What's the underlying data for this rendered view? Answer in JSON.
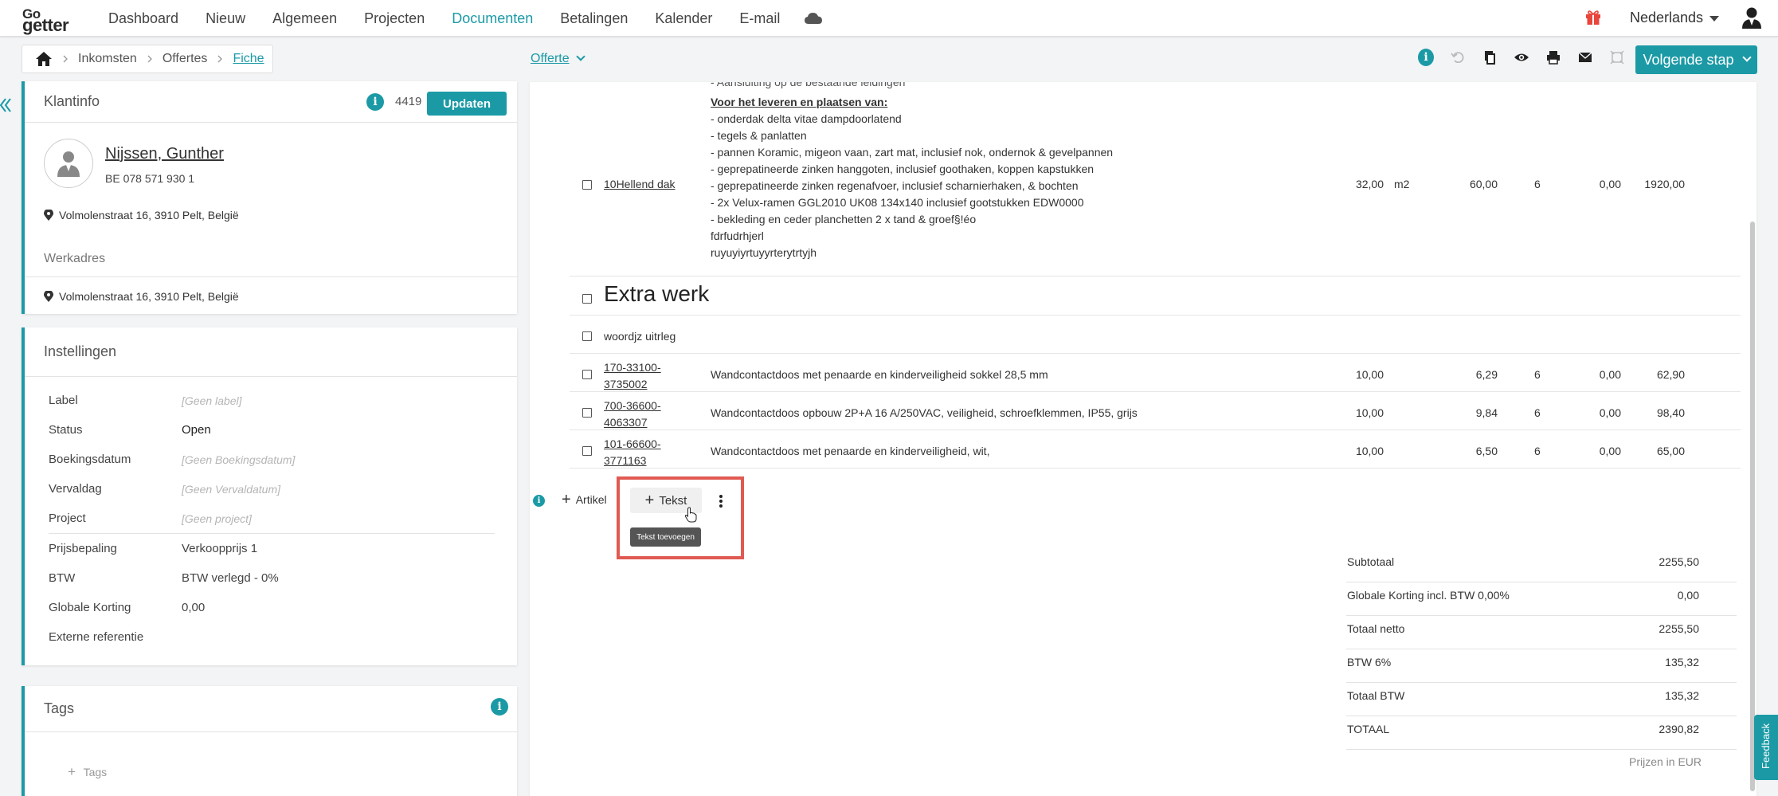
{
  "nav": {
    "logo_top": "Go",
    "logo_bottom": "getter",
    "items": [
      "Dashboard",
      "Nieuw",
      "Algemeen",
      "Projecten",
      "Documenten",
      "Betalingen",
      "Kalender",
      "E-mail"
    ],
    "active": "Documenten",
    "language": "Nederlands"
  },
  "breadcrumb": {
    "items": [
      "Inkomsten",
      "Offertes",
      "Fiche"
    ]
  },
  "doc_type": "Offerte",
  "next_step_label": "Volgende stap",
  "klantinfo": {
    "title": "Klantinfo",
    "number": "4419",
    "update_label": "Updaten",
    "name": "Nijssen, Gunther",
    "vat": "BE 078 571 930 1",
    "address": "Volmolenstraat 16, 3910 Pelt, België",
    "werkadres_label": "Werkadres",
    "werkadres": "Volmolenstraat 16, 3910 Pelt, België"
  },
  "instellingen": {
    "title": "Instellingen",
    "rows": [
      {
        "label": "Label",
        "value": "[Geen label]"
      },
      {
        "label": "Status",
        "value": "Open"
      },
      {
        "label": "Boekingsdatum",
        "value": "[Geen Boekingsdatum]"
      },
      {
        "label": "Vervaldag",
        "value": "[Geen Vervaldatum]"
      },
      {
        "label": "Project",
        "value": "[Geen project]"
      },
      {
        "label": "Prijsbepaling",
        "value": "Verkoopprijs 1"
      },
      {
        "label": "BTW",
        "value": "BTW verlegd - 0%"
      },
      {
        "label": "Globale Korting",
        "value": "0,00"
      },
      {
        "label": "Externe referentie",
        "value": ""
      }
    ]
  },
  "tags": {
    "title": "Tags",
    "add_label": "Tags"
  },
  "document": {
    "cut_line": "- Aansluiting op de bestaande leidingen",
    "main_item": {
      "code": "10Hellend dak",
      "desc_head": "Voor het leveren en plaatsen van:",
      "desc_lines": [
        "- onderdak delta vitae dampdoorlatend",
        "- tegels & panlatten",
        "- pannen Koramic, migeon vaan, zart mat, inclusief nok, ondernok & gevelpannen",
        "- geprepatineerde zinken hanggoten, inclusief goothaken, koppen kapstukken",
        "- geprepatineerde zinken regenafvoer, inclusief scharnierhaken, & bochten",
        "- 2x Velux-ramen GGL2010 UK08 134x140 inclusief gootstukken EDW0000",
        "- bekleding en ceder planchetten 2 x tand & groef§!éo",
        "fdrfudrhjerl",
        "ruyuyiyrtuyyrterytrtyjh"
      ],
      "qty": "32,00",
      "unit": "m2",
      "price": "60,00",
      "vat": "6",
      "discount": "0,00",
      "total": "1920,00"
    },
    "section_title": "Extra werk",
    "text_line": "woordjz uitrleg",
    "items": [
      {
        "code1": "170-33100-",
        "code2": "3735002",
        "desc": "Wandcontactdoos met penaarde en kinderveiligheid sokkel 28,5 mm",
        "qty": "10,00",
        "price": "6,29",
        "vat": "6",
        "discount": "0,00",
        "total": "62,90"
      },
      {
        "code1": "700-36600-",
        "code2": "4063307",
        "desc": "Wandcontactdoos opbouw 2P+A 16 A/250VAC, veiligheid, schroefklemmen, IP55, grijs",
        "qty": "10,00",
        "price": "9,84",
        "vat": "6",
        "discount": "0,00",
        "total": "98,40"
      },
      {
        "code1": "101-66600-",
        "code2": "3771163",
        "desc": "Wandcontactdoos met penaarde en kinderveiligheid, wit,",
        "qty": "10,00",
        "price": "6,50",
        "vat": "6",
        "discount": "0,00",
        "total": "65,00"
      }
    ],
    "add_artikel_label": "Artikel",
    "add_tekst_label": "Tekst",
    "tooltip": "Tekst toevoegen"
  },
  "totals": [
    {
      "label": "Subtotaal",
      "value": "2255,50"
    },
    {
      "label": "Globale Korting incl. BTW 0,00%",
      "value": "0,00"
    },
    {
      "label": "Totaal netto",
      "value": "2255,50"
    },
    {
      "label": "BTW 6%",
      "value": "135,32"
    },
    {
      "label": "Totaal BTW",
      "value": "135,32"
    },
    {
      "label": "TOTAAL",
      "value": "2390,82"
    }
  ],
  "currency_note": "Prijzen in EUR",
  "feedback_label": "Feedback",
  "colors": {
    "accent": "#1b9aa6",
    "highlight": "#e05a52"
  }
}
